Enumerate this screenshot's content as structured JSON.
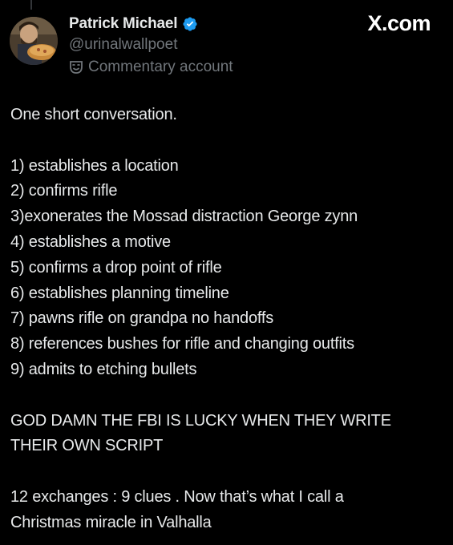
{
  "header": {
    "display_name": "Patrick Michael",
    "handle": "@urinalwallpoet",
    "account_label": "Commentary account",
    "site": "X.com"
  },
  "icons": {
    "verified": "verified-badge-icon",
    "label": "theater-mask-icon"
  },
  "colors": {
    "background": "#000000",
    "text": "#e7e9ea",
    "secondary_text": "#71767b",
    "verified": "#1d9bf0"
  },
  "post": {
    "intro": "One short conversation.",
    "items": [
      "1) establishes a location",
      "2) confirms rifle",
      "3)exonerates the Mossad distraction George zynn",
      "4) establishes a motive",
      "5) confirms a drop point of rifle",
      "6) establishes planning timeline",
      "7) pawns rifle on grandpa no handoffs",
      "8) references bushes for rifle and changing outfits",
      "9) admits to etching bullets"
    ],
    "shout_line1": "GOD DAMN THE FBI IS LUCKY WHEN THEY WRITE",
    "shout_line2": "THEIR OWN SCRIPT",
    "closing_line1": "12 exchanges : 9 clues . Now that’s what I call a",
    "closing_line2": "Christmas miracle in Valhalla"
  }
}
